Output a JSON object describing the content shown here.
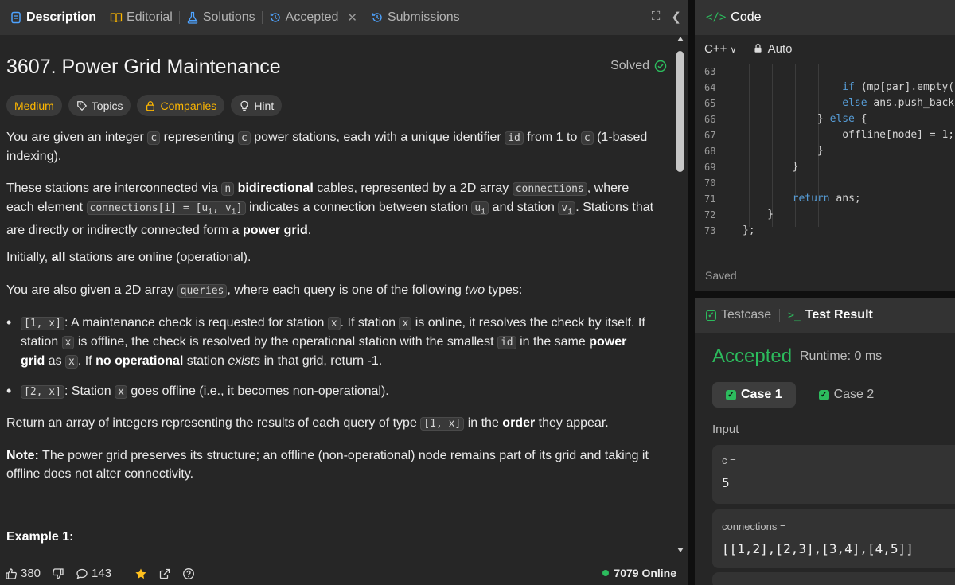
{
  "left_tabs": {
    "description": "Description",
    "editorial": "Editorial",
    "solutions": "Solutions",
    "accepted": "Accepted",
    "submissions": "Submissions"
  },
  "problem": {
    "title": "3607. Power Grid Maintenance",
    "status": "Solved",
    "tags": {
      "difficulty": "Medium",
      "topics": "Topics",
      "companies": "Companies",
      "hint": "Hint"
    },
    "p1": {
      "a": "You are given an integer ",
      "c1": "c",
      "b": " representing ",
      "c2": "c",
      "c": " power stations, each with a unique identifier ",
      "id": "id",
      "d": " from 1 to ",
      "c3": "c",
      "e": " (1-based indexing)."
    },
    "p2": {
      "a": "These stations are interconnected via ",
      "n": "n",
      "b": " ",
      "bold1": "bidirectional",
      "c": " cables, represented by a 2D array ",
      "connections": "connections",
      "d": ", where each element ",
      "conn_i": "connections[i] = [u",
      "sub_i": "i",
      "conn_mid": ", v",
      "sub_i2": "i",
      "conn_end": "]",
      "e": " indicates a connection between station ",
      "u": "u",
      "sub_u": "i",
      "f": " and station ",
      "v": "v",
      "sub_v": "i",
      "g": ". Stations that are directly or indirectly connected form a ",
      "bold2": "power grid",
      "h": "."
    },
    "p3": {
      "a": "Initially, ",
      "bold": "all",
      "b": " stations are online (operational)."
    },
    "p4": {
      "a": "You are also given a 2D array ",
      "queries": "queries",
      "b": ", where each query is one of the following ",
      "em": "two",
      "c": " types:"
    },
    "bullet1": {
      "code": "[1, x]",
      "a": ": A maintenance check is requested for station ",
      "x1": "x",
      "b": ". If station ",
      "x2": "x",
      "c": " is online, it resolves the check by itself. If station ",
      "x3": "x",
      "d": " is offline, the check is resolved by the operational station with the smallest ",
      "id": "id",
      "e": " in the same ",
      "bold1": "power grid",
      "f": " as ",
      "x4": "x",
      "g": ". If ",
      "bold2": "no operational",
      "h": " station ",
      "em": "exists",
      "i": " in that grid, return -1."
    },
    "bullet2": {
      "code": "[2, x]",
      "a": ": Station ",
      "x": "x",
      "b": " goes offline (i.e., it becomes non-operational)."
    },
    "p5": {
      "a": "Return an array of integers representing the results of each query of type ",
      "code": "[1, x]",
      "b": " in the ",
      "bold": "order",
      "c": " they appear."
    },
    "p6": {
      "bold": "Note:",
      "a": " The power grid preserves its structure; an offline (non-operational) node remains part of its grid and taking it offline does not alter connectivity."
    },
    "example_title": "Example 1:"
  },
  "footer": {
    "likes": "380",
    "comments": "143",
    "online": "7079 Online"
  },
  "code": {
    "header": "Code",
    "header_icon": "</>",
    "language": "C++",
    "mode": "Auto",
    "lines": [
      {
        "n": "63",
        "t": ""
      },
      {
        "n": "64",
        "t": "                if (mp[par].empty("
      },
      {
        "n": "65",
        "t": "                else ans.push_back"
      },
      {
        "n": "66",
        "t": "            } else {"
      },
      {
        "n": "67",
        "t": "                offline[node] = 1;"
      },
      {
        "n": "68",
        "t": "            }"
      },
      {
        "n": "69",
        "t": "        }"
      },
      {
        "n": "70",
        "t": ""
      },
      {
        "n": "71",
        "t": "        return ans;"
      },
      {
        "n": "72",
        "t": "    }"
      },
      {
        "n": "73",
        "t": "};"
      }
    ],
    "saved": "Saved"
  },
  "result": {
    "tab_testcase": "Testcase",
    "tab_result": "Test Result",
    "tab_result_icon": ">_",
    "verdict": "Accepted",
    "runtime": "Runtime: 0 ms",
    "cases": [
      "Case 1",
      "Case 2"
    ],
    "input_label": "Input",
    "inputs": [
      {
        "name": "c =",
        "value": "5"
      },
      {
        "name": "connections =",
        "value": "[[1,2],[2,3],[3,4],[4,5]]"
      }
    ]
  },
  "colors": {
    "accent_green": "#2cbb5d",
    "medium_yellow": "#ffb800",
    "keyword_blue": "#569cd6"
  }
}
